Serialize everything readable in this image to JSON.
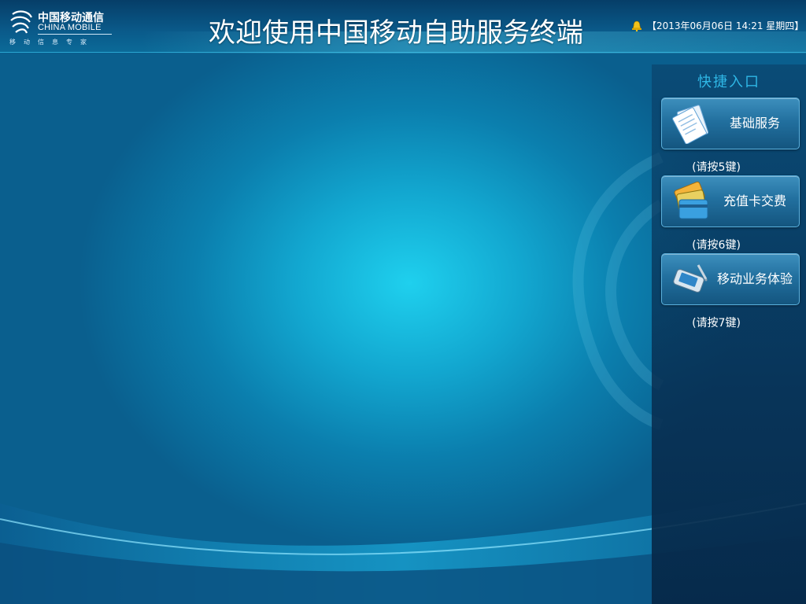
{
  "header": {
    "logo": {
      "name_cn": "中国移动通信",
      "name_en": "CHINA MOBILE",
      "tagline": "移动信息专家",
      "icon": "china-mobile-logo-icon"
    },
    "title": "欢迎使用中国移动自助服务终端",
    "datetime": "【2013年06月06日 14:21 星期四】",
    "status_icon": "bell-icon"
  },
  "panel": {
    "title": "快捷入口",
    "items": [
      {
        "label": "基础服务",
        "hint": "(请按5键)",
        "icon": "documents-icon"
      },
      {
        "label": "充值卡交费",
        "hint": "(请按6键)",
        "icon": "cards-icon"
      },
      {
        "label": "移动业务体验",
        "hint": "(请按7键)",
        "icon": "pda-device-icon"
      }
    ]
  },
  "colors": {
    "accent": "#2fb7e6",
    "header_bg": "#063e68",
    "button_bg": "#22709f"
  }
}
